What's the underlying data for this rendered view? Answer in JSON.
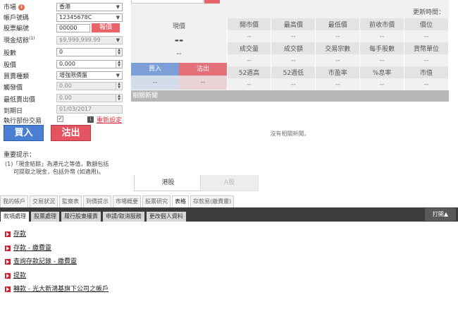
{
  "order_form": {
    "market": {
      "label": "市場",
      "value": "香港"
    },
    "account": {
      "label": "帳戶號碼",
      "value": "12345678C"
    },
    "stock_code": {
      "label": "股票編號",
      "value": "00000",
      "query_button": "報價"
    },
    "cash_balance": {
      "label": "現金結餘",
      "superscript": "(1)",
      "value": "$9,999,999.99"
    },
    "quantity": {
      "label": "股數",
      "value": "0"
    },
    "price": {
      "label": "股價",
      "value": "0.000"
    },
    "order_type": {
      "label": "買賣種類",
      "value": "增強限價盤"
    },
    "trigger_price": {
      "label": "觸發價",
      "value": "0.00"
    },
    "min_ask": {
      "label": "最低賣出價",
      "value": "0.00"
    },
    "expiry": {
      "label": "到期日",
      "value": "01/03/2017"
    },
    "partial": {
      "label": "執行部份交易",
      "checked": "✓"
    },
    "reset_label": "重新設定",
    "buy_button": "買入",
    "sell_button": "沽出",
    "notice": {
      "title": "重要提示：",
      "lines": [
        "(1)「現金結餘」為港元之等值，數額包括",
        "可提取之現金，包括外幣 (如適用)。"
      ]
    }
  },
  "quote": {
    "update_label": "更新時間：",
    "price_label": "現價",
    "price_value": "--",
    "change_value": "--",
    "headers_row1": [
      "開市價",
      "最高價",
      "最低價",
      "前收市價",
      "價位"
    ],
    "values_row1": [
      "--",
      "--",
      "--",
      "--",
      "--"
    ],
    "headers_row2": [
      "成交量",
      "成交額",
      "交易宗數",
      "每手股數",
      "貨幣單位"
    ],
    "values_row2": [
      "--",
      "--",
      "--",
      "--",
      "--"
    ],
    "headers_row3": [
      "52週高",
      "52週低",
      "市盈率",
      "%息率",
      "市值"
    ],
    "values_row3": [
      "--",
      "--",
      "--",
      "--",
      "--"
    ],
    "bid_label": "買入",
    "ask_label": "沽出",
    "bid_value": "--",
    "ask_value": "--",
    "news_header": "相關新聞",
    "no_news": "沒有相關新聞。",
    "market_tab_hk": "港股",
    "market_tab_a": "A股"
  },
  "nav_tabs": [
    "我的帳戶",
    "交易狀況",
    "監察表",
    "到價提示",
    "市場概要",
    "股票研究",
    "表格",
    "存款易(繳費靈)"
  ],
  "nav_active": "表格",
  "sub_tabs": [
    "款項處理",
    "股票處理",
    "履行股東權責",
    "申請/取消服務",
    "更改個人資料"
  ],
  "sub_active": "款項處理",
  "open_label": "打開▲",
  "links": [
    "存款",
    "存款 - 繳費靈",
    "查詢存款記錄 - 繳費靈",
    "提款",
    "轉款 - 光大新鴻基旗下公司之帳戶"
  ]
}
